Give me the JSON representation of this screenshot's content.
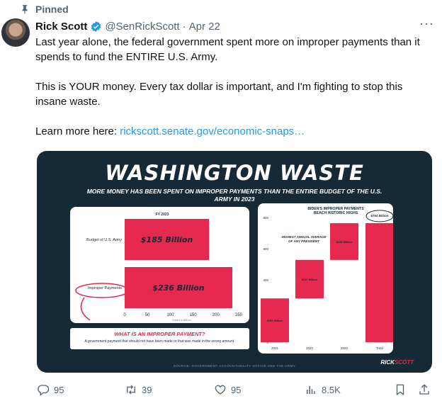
{
  "pinned": {
    "label": "Pinned",
    "icon": "pin-icon"
  },
  "author": {
    "name": "Rick Scott",
    "handle": "@SenRickScott",
    "separator": "·",
    "date": "Apr 22",
    "verified_color": "#1d9bf0"
  },
  "tweet": {
    "p1": "Last year alone, the federal government spent more on improper payments than it spends to fund the ENTIRE U.S. Army.",
    "p2": "This is YOUR money. Every tax dollar is important, and I'm fighting to stop this insane waste.",
    "p3_prefix": "Learn more here: ",
    "p3_link": "rickscott.senate.gov/economic-snaps…"
  },
  "media": {
    "title": "WASHINGTON WASTE",
    "subtitle": "More money has been spent on improper payments than the entire budget of the U.S. Army in 2023",
    "improper_question": "WHAT IS AN IMPROPER PAYMENT?",
    "improper_answer": "A government payment that should not have been made or that was made in the wrong amount.",
    "source": "SOURCE: GOVERNMENT ACCOUNTABILITY OFFICE AND THE ARMY",
    "logo_prefix": "RICK",
    "logo_suffix": "SCOTT",
    "brand_red": "#e5294e",
    "brand_navy": "#152a36"
  },
  "chart_data": [
    {
      "type": "bar",
      "orientation": "horizontal",
      "title": "FY 2023",
      "categories": [
        "Budget of U.S. Army",
        "Improper Payments"
      ],
      "values": [
        185,
        236
      ],
      "data_labels": [
        "$185 Billion",
        "$236 Billion"
      ],
      "xticks": [
        "0",
        "50",
        "100",
        "150",
        "200",
        "250"
      ],
      "xlabel": "Dollars in Billions",
      "xlim": [
        0,
        250
      ]
    },
    {
      "type": "bar",
      "subtype": "waterfall",
      "title": "BIDEN'S IMPROPER PAYMENTS REACH HISTORIC HIGHS",
      "annotation": "HIGHEST ANNUAL AVERAGE OF ANY PRESIDENT",
      "categories": [
        "2021",
        "2022",
        "2023",
        "Total"
      ],
      "values": [
        281,
        247,
        236,
        764
      ],
      "data_labels": [
        "$281 Billion",
        "$247 Billion",
        "$236 Billion",
        "$764 Billion"
      ],
      "yticks": [
        "0",
        "200",
        "400",
        "600",
        "800"
      ],
      "ylim": [
        0,
        800
      ]
    }
  ],
  "actions": {
    "replies": "95",
    "reposts": "39",
    "likes": "95",
    "views": "8.5K"
  }
}
